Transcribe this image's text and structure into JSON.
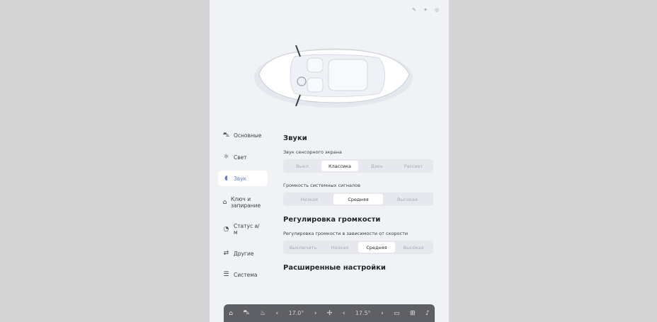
{
  "status": {
    "icons": [
      "edit-icon",
      "bluetooth-icon",
      "visibility-icon"
    ]
  },
  "sidebar": {
    "items": [
      {
        "label": "Основные",
        "icon": "car-icon"
      },
      {
        "label": "Свет",
        "icon": "light-icon"
      },
      {
        "label": "Звук",
        "icon": "sound-icon",
        "active": true
      },
      {
        "label": "Ключ и запирание",
        "icon": "lock-icon"
      },
      {
        "label": "Статус а/м",
        "icon": "status-icon"
      },
      {
        "label": "Другие",
        "icon": "other-icon"
      },
      {
        "label": "Система",
        "icon": "system-icon"
      }
    ]
  },
  "content": {
    "section_sounds": "Звуки",
    "touch_label": "Звук сенсорного экрана",
    "touch_options": [
      "Выкл.",
      "Классика",
      "Дзен",
      "Рассвет"
    ],
    "touch_selected": 1,
    "system_label": "Громкость системных сигналов",
    "system_options": [
      "Низкая",
      "Средняя",
      "Высокая"
    ],
    "system_selected": 1,
    "section_volume": "Регулировка громкости",
    "speed_label": "Регулировка громкости в зависимости от скорости",
    "speed_options": [
      "Выключить",
      "Низкая",
      "Средняя",
      "Высокая"
    ],
    "speed_selected": 2,
    "section_advanced": "Расширенные настройки"
  },
  "dock": {
    "temp_left": "17.0°",
    "temp_right": "17.5°"
  },
  "colors": {
    "accent": "#5b7ce0",
    "background": "#f1f2f6",
    "dock": "#5f6066"
  }
}
